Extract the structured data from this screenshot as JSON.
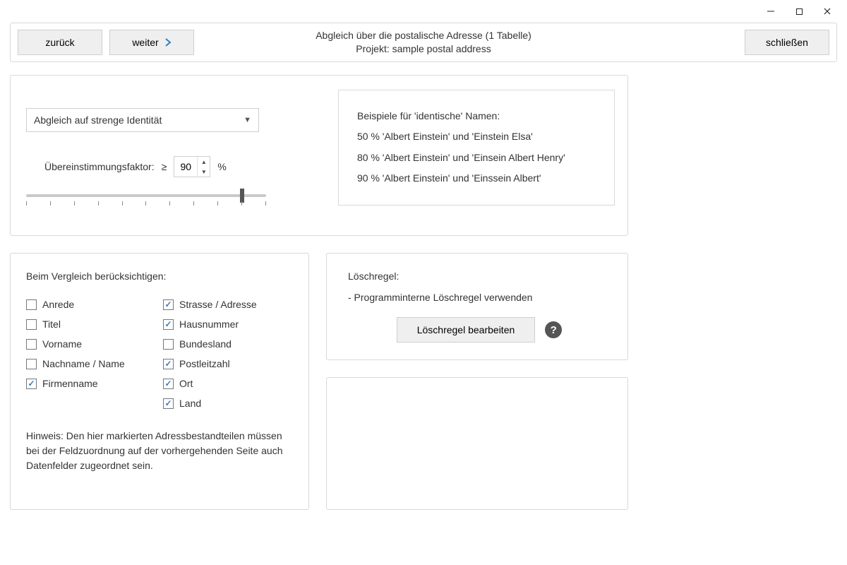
{
  "window": {
    "minimize": "—",
    "maximize": "☐",
    "close": "✕"
  },
  "topbar": {
    "back_label": "zurück",
    "next_label": "weiter",
    "close_label": "schließen",
    "title1": "Abgleich über die postalische Adresse (1 Tabelle)",
    "title2": "Projekt: sample postal address"
  },
  "match_panel": {
    "mode_label": "Abgleich auf strenge Identität",
    "factor_label": "Übereinstimmungsfaktor:",
    "operator": "≥",
    "factor_value": "90",
    "unit": "%"
  },
  "examples": {
    "heading": "Beispiele für 'identische' Namen:",
    "line1": "50 %  'Albert Einstein' und 'Einstein Elsa'",
    "line2": "80 %  'Albert Einstein' und 'Einsein Albert Henry'",
    "line3": "90 %  'Albert Einstein' und 'Einssein Albert'"
  },
  "fields_panel": {
    "heading": "Beim Vergleich berücksichtigen:",
    "hint": "Hinweis: Den hier markierten Adressbestandteilen müssen bei der Feldzuordnung auf der vorhergehenden Seite auch Datenfelder zugeordnet sein.",
    "items": {
      "anrede": {
        "label": "Anrede",
        "checked": false
      },
      "strasse": {
        "label": "Strasse / Adresse",
        "checked": true
      },
      "titel": {
        "label": "Titel",
        "checked": false
      },
      "hausnummer": {
        "label": "Hausnummer",
        "checked": true
      },
      "vorname": {
        "label": "Vorname",
        "checked": false
      },
      "bundesland": {
        "label": "Bundesland",
        "checked": false
      },
      "nachname": {
        "label": "Nachname / Name",
        "checked": false
      },
      "plz": {
        "label": "Postleitzahl",
        "checked": true
      },
      "firmenname": {
        "label": "Firmenname",
        "checked": true
      },
      "ort": {
        "label": "Ort",
        "checked": true
      },
      "land": {
        "label": "Land",
        "checked": true
      }
    }
  },
  "delete_panel": {
    "label": "Löschregel:",
    "rule_text": "- Programminterne Löschregel verwenden",
    "edit_label": "Löschregel bearbeiten",
    "help": "?"
  }
}
